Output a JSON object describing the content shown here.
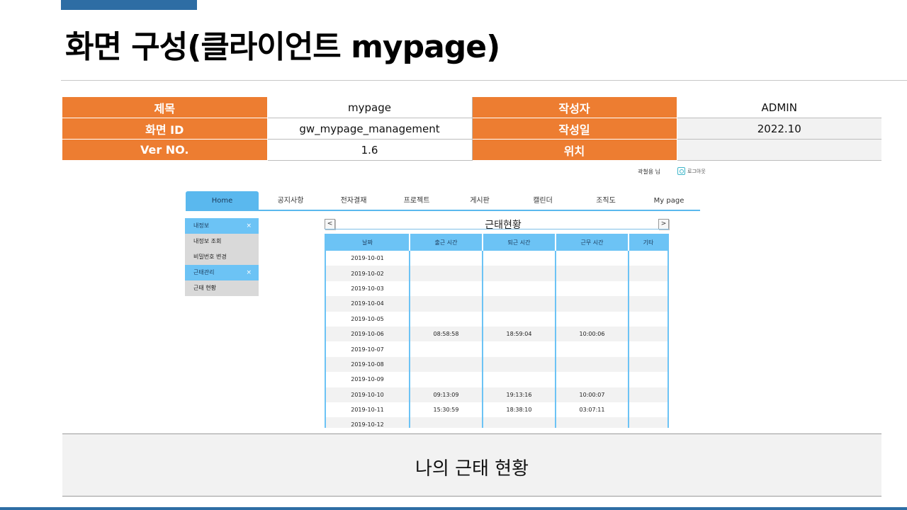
{
  "slide": {
    "title": "화면 구성(클라이언트 mypage)",
    "caption": "나의 근태 현황"
  },
  "info": {
    "rows": [
      {
        "label1": "제목",
        "value1": "mypage",
        "label2": "작성자",
        "value2": "ADMIN"
      },
      {
        "label1": "화면 ID",
        "value1": "gw_mypage_management",
        "label2": "작성일",
        "value2": "2022.10"
      },
      {
        "label1": "Ver NO.",
        "value1": "1.6",
        "label2": "위치",
        "value2": ""
      }
    ]
  },
  "app": {
    "user_text": "곽철용 님",
    "logout_label": "로그아웃",
    "nav": [
      "Home",
      "공지사항",
      "전자결재",
      "프로젝트",
      "게시판",
      "캘린더",
      "조직도",
      "My page"
    ],
    "sidebar": {
      "group1": {
        "label": "내정보",
        "close": "×"
      },
      "group1_items": [
        "내정보 조회",
        "비밀번호 변경"
      ],
      "group2": {
        "label": "근태관리",
        "close": "×"
      },
      "group2_items": [
        "근태 현황"
      ]
    },
    "calendar": {
      "title": "근태현황",
      "prev": "<",
      "next": ">"
    },
    "table": {
      "headers": [
        "날짜",
        "출근 시간",
        "퇴근 시간",
        "근무 시간",
        "기타"
      ],
      "rows": [
        [
          "2019-10-01",
          "",
          "",
          "",
          ""
        ],
        [
          "2019-10-02",
          "",
          "",
          "",
          ""
        ],
        [
          "2019-10-03",
          "",
          "",
          "",
          ""
        ],
        [
          "2019-10-04",
          "",
          "",
          "",
          ""
        ],
        [
          "2019-10-05",
          "",
          "",
          "",
          ""
        ],
        [
          "2019-10-06",
          "08:58:58",
          "18:59:04",
          "10:00:06",
          ""
        ],
        [
          "2019-10-07",
          "",
          "",
          "",
          ""
        ],
        [
          "2019-10-08",
          "",
          "",
          "",
          ""
        ],
        [
          "2019-10-09",
          "",
          "",
          "",
          ""
        ],
        [
          "2019-10-10",
          "09:13:09",
          "19:13:16",
          "10:00:07",
          ""
        ],
        [
          "2019-10-11",
          "15:30:59",
          "18:38:10",
          "03:07:11",
          ""
        ],
        [
          "2019-10-12",
          "",
          "",
          "",
          ""
        ]
      ]
    }
  },
  "colors": {
    "accent_orange": "#ed7d31",
    "accent_blue": "#5ab8ee",
    "header_bar": "#2e6da4"
  }
}
